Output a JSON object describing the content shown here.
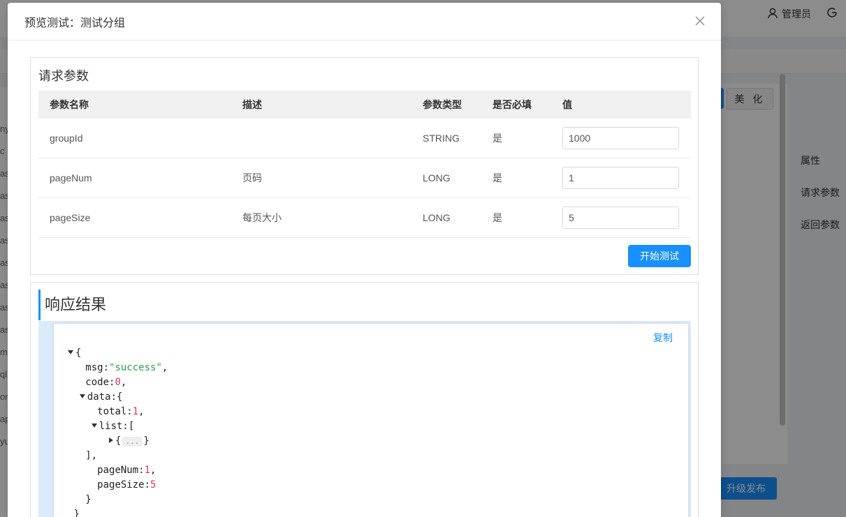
{
  "background": {
    "user_label": "管理员",
    "beautify_label": "美 化",
    "side_nav": [
      "属性",
      "请求参数",
      "返回参数"
    ],
    "upgrade_label": "升级发布",
    "left_list": [
      "ny",
      "c",
      "as",
      "as",
      "as",
      "as",
      "as",
      "as",
      "as",
      "as",
      "m",
      "ql",
      "orr",
      "ap",
      "yu"
    ]
  },
  "modal": {
    "title": "预览测试：测试分组",
    "close_icon": "close-icon"
  },
  "request": {
    "title": "请求参数",
    "columns": [
      "参数名称",
      "描述",
      "参数类型",
      "是否必填",
      "值"
    ],
    "rows": [
      {
        "name": "groupId",
        "desc": "",
        "type": "STRING",
        "required": "是",
        "value": "1000"
      },
      {
        "name": "pageNum",
        "desc": "页码",
        "type": "LONG",
        "required": "是",
        "value": "1"
      },
      {
        "name": "pageSize",
        "desc": "每页大小",
        "type": "LONG",
        "required": "是",
        "value": "5"
      }
    ],
    "start_label": "开始测试"
  },
  "response": {
    "title": "响应结果",
    "copy_label": "复制",
    "json": {
      "open_brace": "{",
      "msg_key": "msg:",
      "msg_val": "\"success\"",
      "code_key": "code:",
      "code_val": "0",
      "data_key": "data:",
      "data_open": "{",
      "total_key": "total:",
      "total_val": "1",
      "list_key": "list:",
      "list_open": "[",
      "collapsed_open": "{",
      "collapsed_dots": "...",
      "collapsed_close": "}",
      "list_close": "],",
      "pageNum_key": "pageNum:",
      "pageNum_val": "1",
      "pageSize_key": "pageSize:",
      "pageSize_val": "5",
      "data_close": "}",
      "close_brace": "}"
    }
  }
}
